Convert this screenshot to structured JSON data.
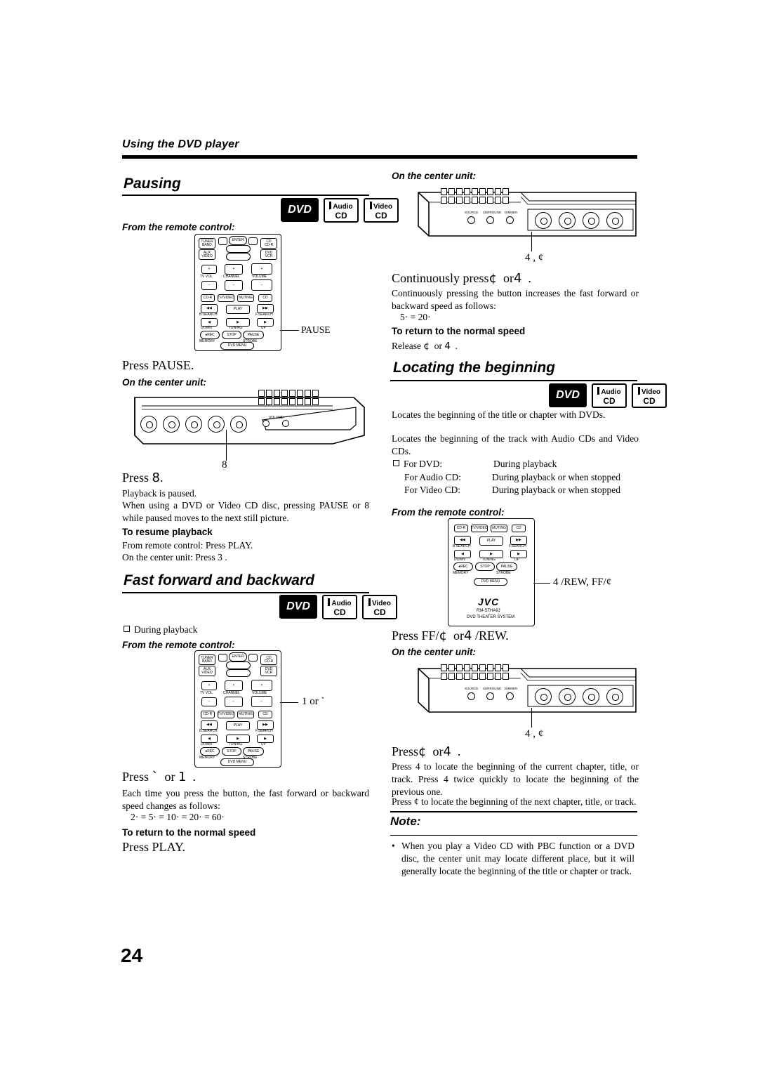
{
  "page": {
    "running_header": "Using the DVD player",
    "number": "24"
  },
  "left_column": {
    "pausing": {
      "title": "Pausing",
      "badges": [
        {
          "type": "dvd",
          "line1": "DVD",
          "line2": ""
        },
        {
          "type": "two",
          "line1": "Audio",
          "line2": "CD"
        },
        {
          "type": "two",
          "line1": "Video",
          "line2": "CD"
        }
      ],
      "from_remote_label": "From the remote control:",
      "callout_pause": "PAUSE",
      "press_remote": "Press PAUSE.",
      "on_center_label": "On the center unit:",
      "callout_number": "8",
      "press_center_pre": "Press",
      "press_center_sym": "8",
      "press_center_post": ".",
      "para1": "Playback is paused.",
      "para2": "When using a DVD or Video CD disc, pressing PAUSE or 8 while paused moves to the next still picture.",
      "resume_heading": "To resume playback",
      "resume_line1": "From remote control: Press PLAY.",
      "resume_line2": "On the center unit: Press 3 ."
    },
    "fast_forward": {
      "title": "Fast forward and backward",
      "badges": [
        {
          "type": "dvd",
          "line1": "DVD",
          "line2": ""
        },
        {
          "type": "two",
          "line1": "Audio",
          "line2": "CD"
        },
        {
          "type": "two",
          "line1": "Video",
          "line2": "CD"
        }
      ],
      "during_playback": "During playback",
      "from_remote_label": "From the remote control:",
      "callout": "1   or `",
      "press_line_pre": "Press",
      "press_line_a": "`",
      "press_line_mid": "or",
      "press_line_b": "1",
      "press_line_post": ".",
      "para": "Each time you press the button, the fast forward or backward speed changes as follows:",
      "speeds": "2·  =  5·  =  10·  =  20·  =  60·",
      "return_heading": "To return to the normal speed",
      "return_line": "Press PLAY."
    }
  },
  "right_column": {
    "center_unit_top": {
      "on_center_label": "On the center unit:",
      "callout": "4    ,  ¢"
    },
    "continuously": {
      "heading_pre": "Continuously press",
      "heading_a": "¢",
      "heading_mid": "or",
      "heading_b": "4",
      "heading_post": ".",
      "para": "Continuously pressing the button increases the fast forward or backward speed as follows:",
      "speeds": "5·  =  20·",
      "return_heading": "To return to the normal speed",
      "return_line_pre": "Release",
      "return_line_a": "¢",
      "return_line_mid": "or",
      "return_line_b": "4",
      "return_line_post": "."
    },
    "locating": {
      "title": "Locating the beginning",
      "badges": [
        {
          "type": "dvd",
          "line1": "DVD",
          "line2": ""
        },
        {
          "type": "two",
          "line1": "Audio",
          "line2": "CD"
        },
        {
          "type": "two",
          "line1": "Video",
          "line2": "CD"
        }
      ],
      "para1": "Locates the beginning of the title or chapter with DVDs.",
      "para2": "Locates the beginning of the track with Audio CDs and Video CDs.",
      "list": [
        {
          "label": "For DVD:",
          "value": "During playback"
        },
        {
          "label": "For Audio CD:",
          "value": "During playback or when stopped"
        },
        {
          "label": "For Video CD:",
          "value": "During playback or when stopped"
        }
      ],
      "from_remote_label": "From the remote control:",
      "callout_remote": "4    /REW, FF/¢",
      "remote_model": "RM-STHA9J",
      "remote_system": "DVD THEATER SYSTEM",
      "remote_brand": "JVC",
      "press_remote_pre": "Press FF/",
      "press_remote_a": "¢",
      "press_remote_mid": "or",
      "press_remote_b": "4",
      "press_remote_post": "/REW.",
      "on_center_label": "On the center unit:",
      "callout_center": "4    ,  ¢",
      "press_center_pre": "Press",
      "press_center_a": "¢",
      "press_center_mid": "or",
      "press_center_b": "4",
      "press_center_post": ".",
      "para3": "Press 4   to locate the beginning of the current chapter, title, or track. Press 4   twice quickly to locate the beginning of the previous one.",
      "para4": "Press ¢  to locate the beginning of the next chapter, title, or track."
    },
    "note": {
      "title": "Note:",
      "body": "When you play a Video CD with PBC function or a DVD disc, the center unit may locate different place, but it will generally locate the beginning of the title or chapter or track."
    }
  },
  "remote_buttons": {
    "top_row": [
      "TUNER/BAND",
      "AUX/VIDEO",
      "",
      "",
      "",
      "CD/CD-R",
      "DVD/VCR"
    ],
    "center_cluster": [
      "ENTER"
    ],
    "volume_row": [
      "TV VOL",
      "CHANNEL",
      "VOLUME"
    ],
    "mid_row": [
      "CD-R",
      "TV/VIDEO",
      "MUTING",
      "CD"
    ],
    "search_row": [
      "B.SEARCH",
      "PLAY",
      "F.SEARCH"
    ],
    "tuning_row": [
      "DOWN",
      "TUNING",
      "UP"
    ],
    "bottom_row": [
      "REC",
      "STOP",
      "PAUSE",
      "STROBE"
    ],
    "memory": "MEMORY",
    "dvd_menu": "DVD MENU"
  },
  "center_unit_labels": {
    "sources": "SOURCE",
    "surround": "SURROUND",
    "dimmer": "DIMMER",
    "volume": "VOLUME"
  }
}
